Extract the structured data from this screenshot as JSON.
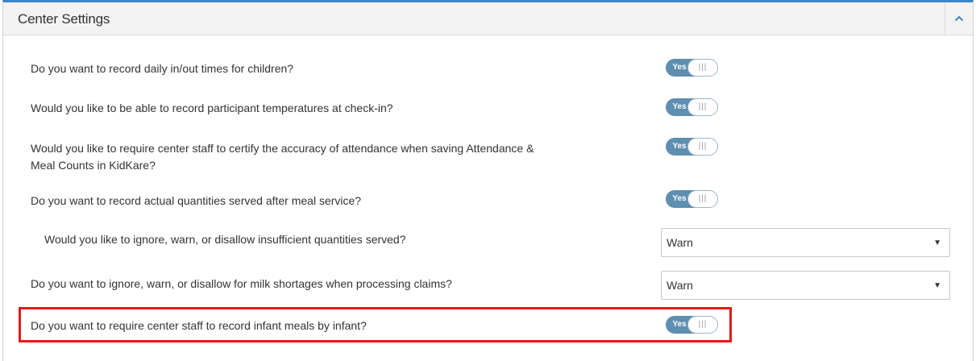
{
  "panel": {
    "title": "Center Settings",
    "collapse_icon": "chevron-up-icon"
  },
  "settings": [
    {
      "question": "Do you want to record daily in/out times for children?",
      "toggle": "Yes"
    },
    {
      "question": "Would you like to be able to record participant temperatures at check-in?",
      "toggle": "Yes"
    },
    {
      "question_line1": "Would you like to require center staff to certify the accuracy of attendance when saving Attendance &",
      "question_line2": "Meal Counts in KidKare?",
      "toggle": "Yes"
    },
    {
      "question": "Do you want to record actual quantities served after meal service?",
      "toggle": "Yes"
    },
    {
      "question": "Would you like to ignore, warn, or disallow insufficient quantities served?",
      "select_value": "Warn"
    },
    {
      "question": "Do you want to ignore, warn, or disallow for milk shortages when processing claims?",
      "select_value": "Warn"
    },
    {
      "question": "Do you want to require center staff to record infant meals by infant?",
      "toggle": "Yes"
    }
  ],
  "colors": {
    "accent_border": "#3f86c6",
    "toggle_on": "#5e8eb0",
    "highlight": "#e11b1b"
  }
}
